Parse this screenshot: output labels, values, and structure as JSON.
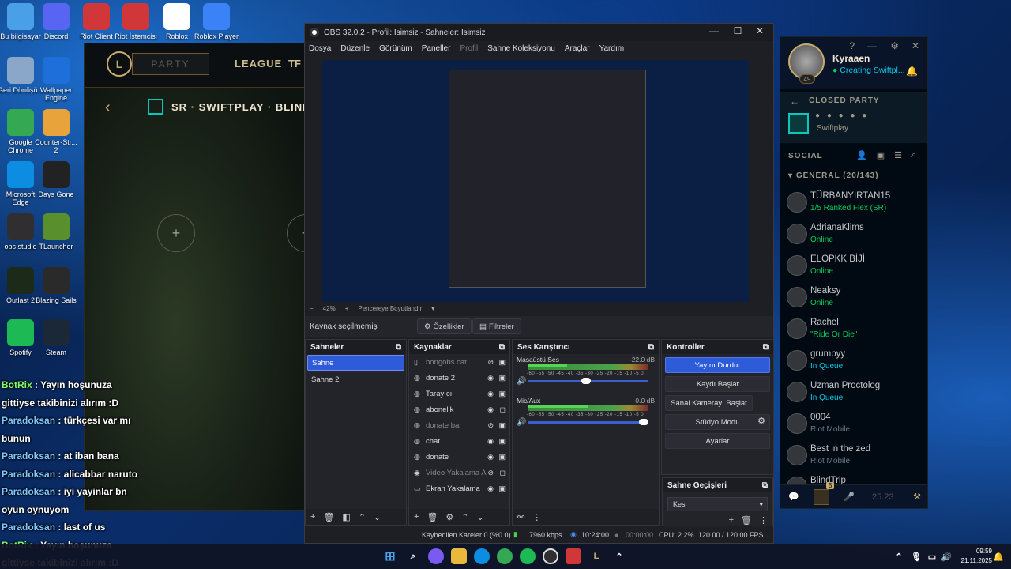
{
  "desktop_icons": [
    {
      "label": "Bu bilgisayar",
      "icon": "computer-icon",
      "color": "#4aa0e6"
    },
    {
      "label": "Discord",
      "icon": "discord-icon",
      "color": "#5865f2"
    },
    {
      "label": "Riot Client",
      "icon": "riot-icon",
      "color": "#d13639"
    },
    {
      "label": "Riot İstemcisi",
      "icon": "riot-icon",
      "color": "#d13639"
    },
    {
      "label": "Roblox",
      "icon": "roblox-icon",
      "color": "#ffffff"
    },
    {
      "label": "Roblox Player",
      "icon": "roblox-player-icon",
      "color": "#3b82f6"
    },
    {
      "label": "Geri Dönüşü...",
      "icon": "recycle-bin-icon",
      "color": "#8aa6c8"
    },
    {
      "label": "Wallpaper Engine",
      "icon": "wallpaper-engine-icon",
      "color": "#1e6fd9"
    },
    {
      "label": "Google Chrome",
      "icon": "chrome-icon",
      "color": "#34a853"
    },
    {
      "label": "Counter-Str... 2",
      "icon": "cs2-icon",
      "color": "#e8a33a"
    },
    {
      "label": "Microsoft Edge",
      "icon": "edge-icon",
      "color": "#0c8de2"
    },
    {
      "label": "Days Gone",
      "icon": "days-gone-icon",
      "color": "#222222"
    },
    {
      "label": "obs studio",
      "icon": "obs-icon",
      "color": "#302e31"
    },
    {
      "label": "TLauncher",
      "icon": "tlauncher-icon",
      "color": "#5a8f2e"
    },
    {
      "label": "Outlast 2",
      "icon": "outlast-icon",
      "color": "#1c2a1a"
    },
    {
      "label": "Blazing Sails",
      "icon": "epic-games-icon",
      "color": "#2a2a2a"
    },
    {
      "label": "Spotify",
      "icon": "spotify-icon",
      "color": "#1db954"
    },
    {
      "label": "Steam",
      "icon": "steam-icon",
      "color": "#1b2838"
    }
  ],
  "league": {
    "party_label": "PARTY",
    "nav_league": "LEAGUE",
    "nav_tft": "TF",
    "mode_title": "SR · SWIFTPLAY · BLIND"
  },
  "chat": [
    {
      "name": "BotRix",
      "sep": " : ",
      "msg": "Yayın hoşunuza",
      "cont": "gittiyse takibinizi alırım :D",
      "type": "bot"
    },
    {
      "name": "Paradoksan",
      "sep": " : ",
      "msg": "türkçesi var mı",
      "cont": "bunun",
      "type": "user"
    },
    {
      "name": "Paradoksan",
      "sep": " : ",
      "msg": "at iban bana",
      "cont": "",
      "type": "user"
    },
    {
      "name": "Paradoksan",
      "sep": " : ",
      "msg": "alicabbar naruto",
      "cont": "",
      "type": "user"
    },
    {
      "name": "Paradoksan",
      "sep": " : ",
      "msg": "iyi yayinlar bn",
      "cont": "oyun oynuyom",
      "type": "user"
    },
    {
      "name": "Paradoksan",
      "sep": " : ",
      "msg": "last of us",
      "cont": "",
      "type": "user"
    },
    {
      "name": "BotRix",
      "sep": " : ",
      "msg": "Yayın hoşunuza",
      "cont": "gittiyse takibinizi alırım :D",
      "type": "bot"
    }
  ],
  "obs": {
    "title": "OBS 32.0.2 - Profil: İsimsiz - Sahneler: İsimsiz",
    "menu": [
      "Dosya",
      "Düzenle",
      "Görünüm",
      "Paneller",
      "Profil",
      "Sahne Koleksiyonu",
      "Araçlar",
      "Yardım"
    ],
    "zoom_minus": "−",
    "zoom": "42%",
    "zoom_plus": "+",
    "fit_label": "Pencereye Boyutlandır",
    "no_source": "Kaynak seçilmemiş",
    "properties": "Özellikler",
    "filters": "Filtreler",
    "scenes_title": "Sahneler",
    "scenes": [
      "Sahne",
      "Sahne 2"
    ],
    "sources_title": "Kaynaklar",
    "sources": [
      {
        "name": "bongobs cat",
        "icon": "doc",
        "visible": false,
        "locked": true
      },
      {
        "name": "donate 2",
        "icon": "globe",
        "visible": true,
        "locked": true
      },
      {
        "name": "Tarayıcı",
        "icon": "globe",
        "visible": true,
        "locked": true
      },
      {
        "name": "abonelik",
        "icon": "globe",
        "visible": true,
        "locked": false
      },
      {
        "name": "donate bar",
        "icon": "globe",
        "visible": false,
        "locked": true
      },
      {
        "name": "chat",
        "icon": "globe",
        "visible": true,
        "locked": true
      },
      {
        "name": "donate",
        "icon": "globe",
        "visible": true,
        "locked": true
      },
      {
        "name": "Video Yakalama A",
        "icon": "camera",
        "visible": false,
        "locked": false
      },
      {
        "name": "Ekran Yakalama",
        "icon": "monitor",
        "visible": true,
        "locked": true
      }
    ],
    "mixer_title": "Ses Karıştırıcı",
    "mixer": [
      {
        "name": "Masaüstü Ses",
        "db": "-22.0 dB",
        "level": 0.32,
        "volume": 0.48
      },
      {
        "name": "Mic/Aux",
        "db": "0.0 dB",
        "level": 0.5,
        "volume": 1.0
      }
    ],
    "meter_ticks": "-60 -55 -50 -45 -40 -35 -30 -25 -20 -15 -10 -5 0",
    "controls_title": "Kontroller",
    "controls": [
      "Yayını Durdur",
      "Kaydı Başlat",
      "Sanal Kamerayı Başlat",
      "Stüdyo Modu",
      "Ayarlar"
    ],
    "transitions_title": "Sahne Geçişleri",
    "transition": "Kes",
    "status": {
      "dropped": "Kaybedilen Kareler 0 (%0.0)",
      "bitrate": "7960 kbps",
      "stream_time": "10:24:00",
      "rec_time": "00:00:00",
      "cpu": "CPU: 2.2%",
      "fps": "120.00 / 120.00 FPS"
    }
  },
  "social": {
    "username": "Kyraaen",
    "level": "49",
    "status": "Creating Swiftpl...",
    "party_label": "CLOSED PARTY",
    "party_mode": "Swiftplay",
    "social_label": "SOCIAL",
    "group_label": "GENERAL (20/143)",
    "friends": [
      {
        "name": "TÜRBANYIRTAN15",
        "status": "1/5 Ranked Flex (SR)",
        "kind": "online"
      },
      {
        "name": "AdrianaKlims",
        "status": "Online",
        "kind": "online"
      },
      {
        "name": "ELOPKK BİJİ",
        "status": "Online",
        "kind": "online"
      },
      {
        "name": "Neaksy",
        "status": "Online",
        "kind": "online"
      },
      {
        "name": "Rachel",
        "status": "\"Ride Or Die\"",
        "kind": "online"
      },
      {
        "name": "grumpyy",
        "status": "In Queue",
        "kind": "queue"
      },
      {
        "name": "Uzman Proctolog",
        "status": "In Queue",
        "kind": "queue"
      },
      {
        "name": "0004",
        "status": "Riot Mobile",
        "kind": "mobile"
      },
      {
        "name": "Best in the zed",
        "status": "Riot Mobile",
        "kind": "mobile"
      },
      {
        "name": "BlindTrip",
        "status": "",
        "kind": "mobile"
      }
    ],
    "footer_badge": "5",
    "footer_version": "25.23"
  },
  "taskbar": {
    "time": "09:59",
    "date": "21.11.2025"
  }
}
